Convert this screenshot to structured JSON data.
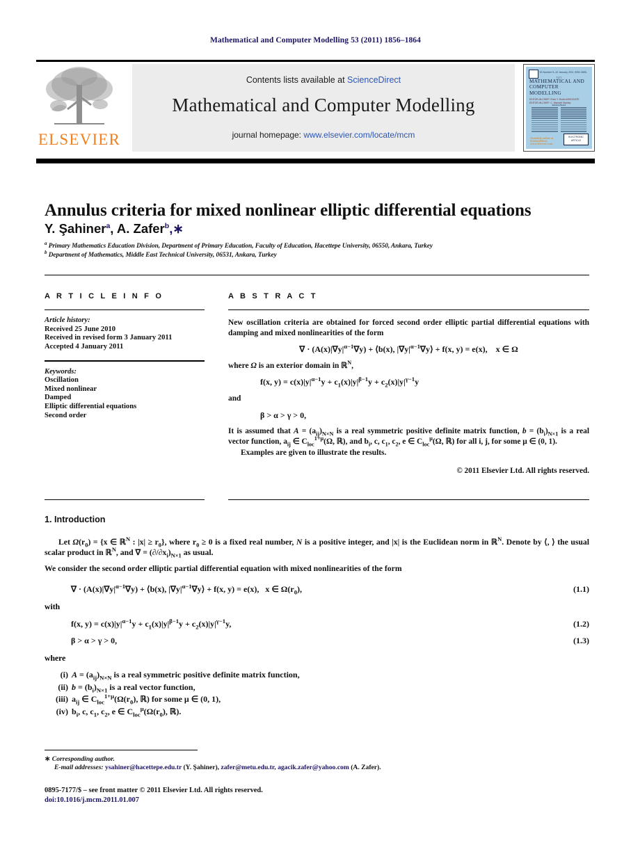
{
  "running_head": "Mathematical and Computer Modelling 53 (2011) 1856–1864",
  "masthead": {
    "contents_prefix": "Contents lists available at ",
    "contents_link": "ScienceDirect",
    "journal_name": "Mathematical and Computer Modelling",
    "homepage_prefix": "journal homepage: ",
    "homepage_url": "www.elsevier.com/locate/mcm",
    "publisher_wordmark": "ELSEVIER",
    "publisher_color": "#f08020",
    "link_color": "#2b56b4"
  },
  "cover": {
    "topbar": "Volume 53 Number 9–10  January 2011                     ISSN 0895-7177",
    "title": "MATHEMATICAL AND COMPUTER MODELLING",
    "subtitle": "EDITOR-IN-CHIEF: Ervin Y. Rodin\nASSOCIATE EDITOR-IN-CHIEF: C. Maxwell Stanley",
    "board_header": "Editorial Board",
    "footer_left": "Available online at\nScienceDirect\nwww.elsevier.com",
    "footer_right_top": "Also available on",
    "footer_right_main": "ELECTRONIC",
    "footer_right_sub": "ARTICLE"
  },
  "article": {
    "title": "Annulus criteria for mixed nonlinear elliptic differential equations",
    "authors_html": "Y. Şahiner<sup>a</sup>, A. Zafer<sup>b</sup><span class=\"star\">,∗</span>",
    "affiliation_a": "Primary Mathematics Education Division, Department of Primary Education, Faculty of Education, Hacettepe University, 06550, Ankara, Turkey",
    "affiliation_b": "Department of Mathematics, Middle East Technical University, 06531, Ankara, Turkey"
  },
  "article_info": {
    "heading": "A R T I C L E   I N F O",
    "history_label": "Article history:",
    "history": [
      "Received 25 June 2010",
      "Received in revised form 3 January 2011",
      "Accepted 4 January 2011"
    ],
    "keywords_label": "Keywords:",
    "keywords": [
      "Oscillation",
      "Mixed nonlinear",
      "Damped",
      "Elliptic differential equations",
      "Second order"
    ]
  },
  "abstract": {
    "heading": "A B S T R A C T",
    "para1": "New oscillation criteria are obtained for forced second order elliptic partial differential equations with damping and mixed nonlinearities of the form",
    "eq1": "∇ · (A(x)|∇y|<sup>α−1</sup>∇y) + ⟨b(x), |∇y|<sup>α−1</sup>∇y⟩ + f(x, y) = e(x),&nbsp;&nbsp;&nbsp; x ∈ Ω",
    "para2_html": "where <i>Ω</i> is an exterior domain in ℝ<sup>N</sup>,",
    "eq2": "f(x, y) = c(x)|y|<sup>α−1</sup>y + c<sub>1</sub>(x)|y|<sup>β−1</sup>y + c<sub>2</sub>(x)|y|<sup>γ−1</sup>y",
    "para3": "and",
    "eq3": "β > α > γ > 0,",
    "para4_html": "It is assumed that <i>A</i> = (a<sub>ij</sub>)<sub>N×N</sub> is a real symmetric positive definite matrix function, <i>b</i> = (b<sub>i</sub>)<sub>N×1</sub> is a real vector function, a<sub>ij</sub> ∈ C<sub>loc</sub><sup>1+μ</sup>(Ω, ℝ), and b<sub>i</sub>, c, c<sub>1</sub>, c<sub>2</sub>, e ∈ C<sub>loc</sub><sup>μ</sup>(Ω, ℝ) for all i, j, for some μ ∈ (0, 1).",
    "para5": "Examples are given to illustrate the results.",
    "copyright": "© 2011 Elsevier Ltd. All rights reserved."
  },
  "body": {
    "section_title": "1.  Introduction",
    "para1_html": "Let <i>Ω</i>(r<sub>0</sub>) = {x ∈ ℝ<sup>N</sup> : |x| ≥ r<sub>0</sub>}, where r<sub>0</sub> ≥ 0 is a fixed real number, <i>N</i> is a positive integer, and |x| is the Euclidean norm in ℝ<sup>N</sup>. Denote by ⟨, ⟩ the usual scalar product in ℝ<sup>N</sup>, and ∇ = (∂/∂x<sub>i</sub>)<sub>N×1</sub> as usual.",
    "para2": "We consider the second order elliptic partial differential equation with mixed nonlinearities of the form",
    "eq_1_1": "∇ · (A(x)|∇y|<sup>α−1</sup>∇y) + ⟨b(x), |∇y|<sup>α−1</sup>∇y⟩ + f(x, y) = e(x),&nbsp;&nbsp; x ∈ Ω(r<sub>0</sub>),",
    "eq_1_1_tag": "(1.1)",
    "with_word": "with",
    "eq_1_2": "f(x, y) = c(x)|y|<sup>α−1</sup>y + c<sub>1</sub>(x)|y|<sup>β−1</sup>y + c<sub>2</sub>(x)|y|<sup>γ−1</sup>y,",
    "eq_1_2_tag": "(1.2)",
    "eq_1_3": "β > α > γ > 0,",
    "eq_1_3_tag": "(1.3)",
    "where_word": "where",
    "conditions": [
      {
        "num": "(i)",
        "text_html": "<i>A</i> = (a<sub>ij</sub>)<sub>N×N</sub> is a real symmetric positive definite matrix function,"
      },
      {
        "num": "(ii)",
        "text_html": "<i>b</i> = (b<sub>i</sub>)<sub>N×1</sub> is a real vector function,"
      },
      {
        "num": "(iii)",
        "text_html": "a<sub>ij</sub> ∈ C<sub>loc</sub><sup>1+μ</sup>(Ω(r<sub>0</sub>), ℝ) for some μ ∈ (0, 1),"
      },
      {
        "num": "(iv)",
        "text_html": "b<sub>i</sub>, c, c<sub>1</sub>, c<sub>2</sub>, e ∈ C<sub>loc</sub><sup>μ</sup>(Ω(r<sub>0</sub>), ℝ)."
      }
    ]
  },
  "footer": {
    "corresponding_marker": "∗",
    "corresponding_text": "Corresponding author.",
    "email_label": "E-mail addresses:",
    "email_1": "ysahiner@hacettepe.edu.tr",
    "email_1_who": "(Y. Şahiner),",
    "email_2": "zafer@metu.edu.tr",
    "email_3": "agacik.zafer@yahoo.com",
    "email_3_who": "(A. Zafer).",
    "issn_line": "0895-7177/$ – see front matter © 2011 Elsevier Ltd. All rights reserved.",
    "doi_line": "doi:10.1016/j.mcm.2011.01.007",
    "link_color": "#1b1464"
  }
}
